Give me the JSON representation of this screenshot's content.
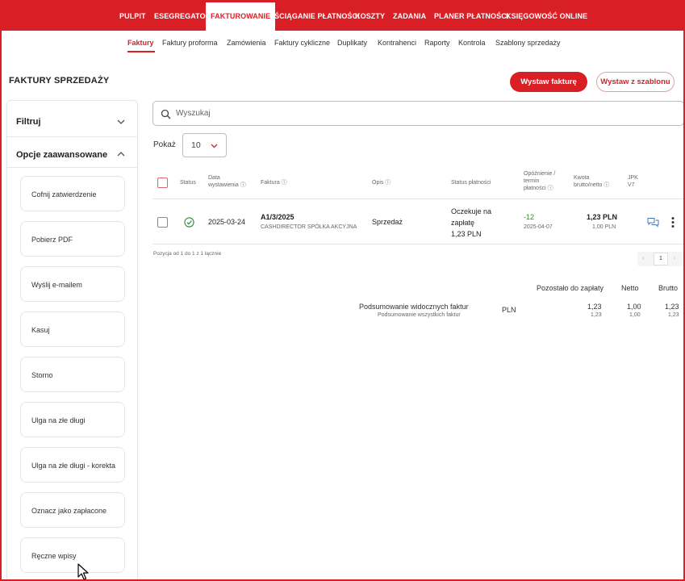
{
  "topnav": {
    "items": [
      "PULPIT",
      "ESEGREGATOR",
      "FAKTUROWANIE",
      "ŚCIĄGANIE PŁATNOŚCI",
      "KOSZTY",
      "ZADANIA",
      "PLANER PŁATNOŚCI",
      "KSIĘGOWOŚĆ ONLINE"
    ],
    "active": "FAKTUROWANIE"
  },
  "subnav": {
    "items": [
      "Faktury",
      "Faktury proforma",
      "Zamówienia",
      "Faktury cykliczne",
      "Duplikaty",
      "Kontrahenci",
      "Raporty",
      "Kontrola",
      "Szablony sprzedaży"
    ],
    "active": "Faktury"
  },
  "page_title": "FAKTURY SPRZEDAŻY",
  "buttons": {
    "issue_invoice": "Wystaw fakturę",
    "issue_from_template": "Wystaw z szablonu"
  },
  "left_panel": {
    "filter_label": "Filtruj",
    "advanced_label": "Opcje zaawansowane",
    "actions": [
      "Cofnij zatwierdzenie",
      "Pobierz PDF",
      "Wyślij e-mailem",
      "Kasuj",
      "Storno",
      "Ulga na złe długi",
      "Ulga na złe długi - korekta",
      "Oznacz jako zapłacone",
      "Ręczne wpisy"
    ]
  },
  "search": {
    "placeholder": "Wyszukaj"
  },
  "page_size": {
    "label": "Pokaż",
    "value": "10"
  },
  "table": {
    "headers": {
      "status": "Status",
      "date_1": "Data",
      "date_2": "wystawienia",
      "invoice": "Faktura",
      "desc": "Opis",
      "pay_status": "Status płatności",
      "delay_1": "Opóźnienie /",
      "delay_2": "termin",
      "delay_3": "płatności",
      "amount_1": "Kwota",
      "amount_2": "brutto/netto",
      "jpk_1": "JPK",
      "jpk_2": "V7"
    },
    "rows": [
      {
        "date": "2025-03-24",
        "number": "A1/3/2025",
        "client": "CASHDIRECTOR SPÓŁKA AKCYJNA",
        "desc": "Sprzedaż",
        "pay_1": "Oczekuje na",
        "pay_2": "zapłatę",
        "pay_3": "1,23 PLN",
        "delay": "-12",
        "due": "2025-04-07",
        "gross": "1,23 PLN",
        "net": "1,00 PLN"
      }
    ],
    "footer": "Pozycja od 1 do 1 z 1 łącznie",
    "page": "1"
  },
  "summary": {
    "headers": {
      "remaining": "Pozostało do zapłaty",
      "net": "Netto",
      "gross": "Brutto"
    },
    "visible_label": "Podsumowanie widocznych faktur",
    "all_label": "Podsumowanie wszystkich faktur",
    "currency": "PLN",
    "visible": {
      "remaining": "1,23",
      "net": "1,00",
      "gross": "1,23"
    },
    "all": {
      "remaining": "1,23",
      "net": "1,00",
      "gross": "1,23"
    }
  }
}
